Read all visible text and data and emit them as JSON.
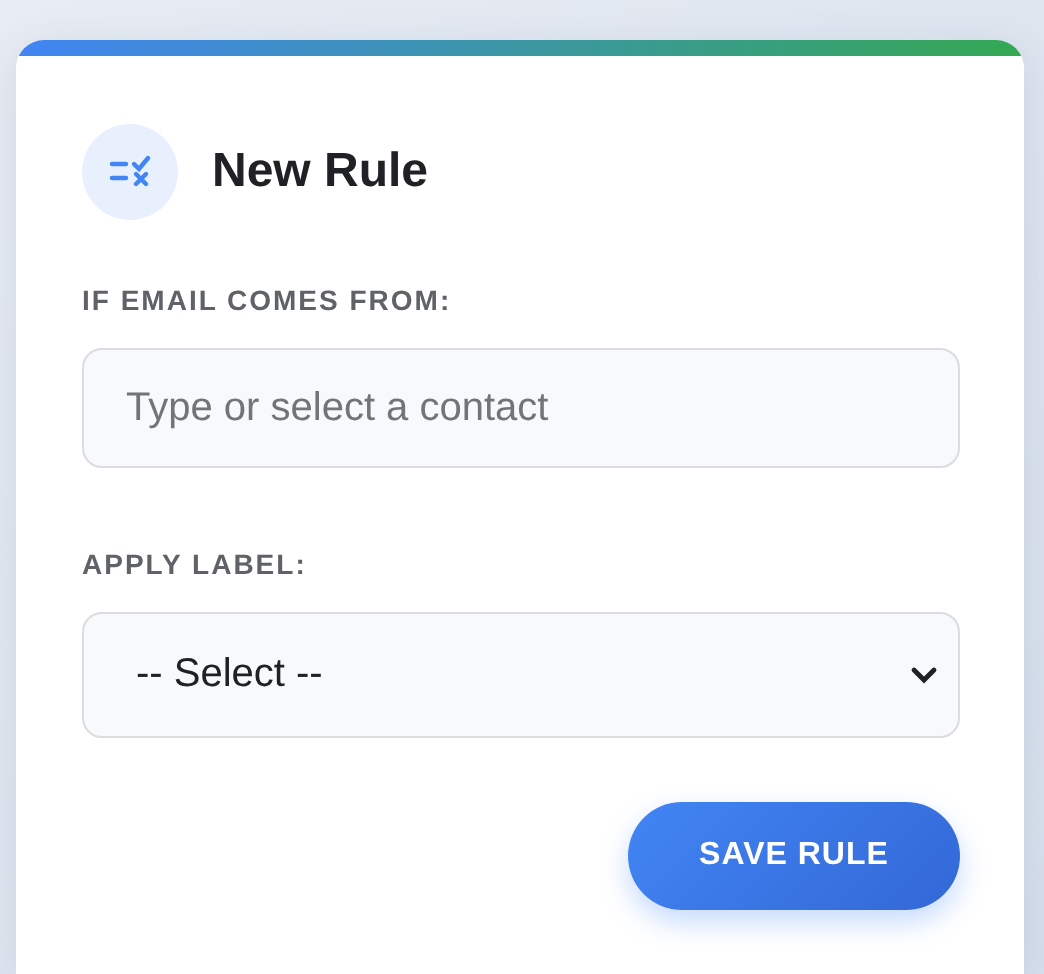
{
  "card": {
    "title": "New Rule"
  },
  "fields": [
    {
      "kind": "input",
      "label": "IF EMAIL COMES FROM:",
      "placeholder": "Type or select a contact"
    },
    {
      "kind": "select",
      "label": "APPLY LABEL:",
      "value": "-- Select --"
    }
  ],
  "buttons": [
    "SAVE RULE"
  ]
}
